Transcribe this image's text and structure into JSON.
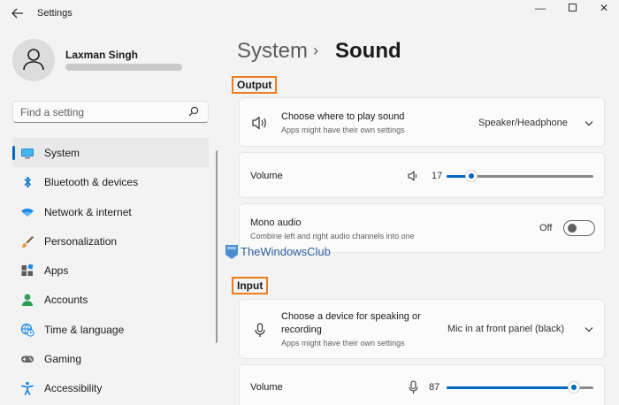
{
  "window": {
    "title": "Settings",
    "back_icon": "back-arrow-icon",
    "minimize": "—",
    "close": "✕"
  },
  "profile": {
    "name": "Laxman Singh"
  },
  "search": {
    "placeholder": "Find a setting"
  },
  "nav": {
    "items": [
      {
        "label": "System",
        "icon": "system-icon",
        "active": true
      },
      {
        "label": "Bluetooth & devices",
        "icon": "bluetooth-icon"
      },
      {
        "label": "Network & internet",
        "icon": "wifi-icon"
      },
      {
        "label": "Personalization",
        "icon": "brush-icon"
      },
      {
        "label": "Apps",
        "icon": "apps-icon"
      },
      {
        "label": "Accounts",
        "icon": "accounts-icon"
      },
      {
        "label": "Time & language",
        "icon": "globe-clock-icon"
      },
      {
        "label": "Gaming",
        "icon": "gamepad-icon"
      },
      {
        "label": "Accessibility",
        "icon": "accessibility-icon"
      }
    ]
  },
  "header": {
    "crumb_parent": "System",
    "crumb_separator": "›",
    "crumb_current": "Sound"
  },
  "output": {
    "section_label": "Output",
    "choose": {
      "title": "Choose where to play sound",
      "subtitle": "Apps might have their own settings",
      "value": "Speaker/Headphone"
    },
    "volume": {
      "label": "Volume",
      "value": "17",
      "level_percent": 17
    },
    "mono": {
      "title": "Mono audio",
      "subtitle": "Combine left and right audio channels into one",
      "state": "Off"
    }
  },
  "input": {
    "section_label": "Input",
    "choose": {
      "title_line1": "Choose a device for speaking or",
      "title_line2": "recording",
      "subtitle": "Apps might have their own settings",
      "value": "Mic in at front panel (black)"
    },
    "volume": {
      "label": "Volume",
      "value": "87",
      "level_percent": 87
    }
  },
  "watermark": {
    "text": "TheWindowsClub"
  },
  "colors": {
    "accent": "#0067c0",
    "highlight_box": "#ee7d1e",
    "background": "#f3f3f3",
    "card": "#fbfbfb"
  }
}
